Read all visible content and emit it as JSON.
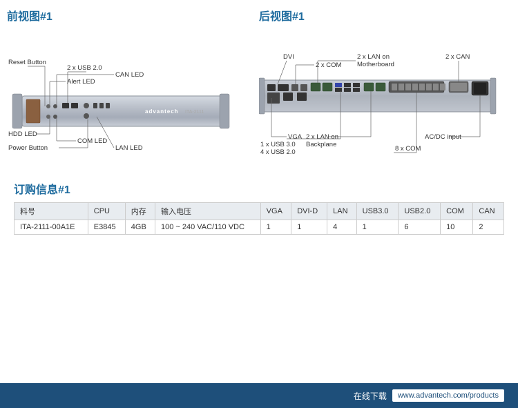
{
  "front_view": {
    "title": "前视图#1",
    "labels": {
      "alert_led": "Alert LED",
      "can_led": "CAN LED",
      "reset_button": "Reset Button",
      "usb": "2 x USB 2.0",
      "hdd_led": "HDD LED",
      "com_led": "COM LED",
      "power_button": "Power Button",
      "lan_led": "LAN LED"
    },
    "chassis_logo": "advantech",
    "chassis_model": "ITA-2111"
  },
  "rear_view": {
    "title": "后视图#1",
    "labels": {
      "dvi": "DVI",
      "two_can": "2 x CAN",
      "two_com": "2 x COM",
      "lan_motherboard": "2 x LAN on\nMotherboard",
      "vga": "VGA",
      "lan_backplane": "2 x LAN on\nBackplane",
      "ac_dc": "AC/DC input",
      "usb_30": "1 x USB 3.0",
      "usb_20": "4 x USB 2.0",
      "eight_com": "8 x COM"
    }
  },
  "ordering": {
    "title": "订购信息#1",
    "headers": [
      "料号",
      "CPU",
      "内存",
      "输入电压",
      "VGA",
      "DVI-D",
      "LAN",
      "USB3.0",
      "USB2.0",
      "COM",
      "CAN"
    ],
    "rows": [
      {
        "part_number": "ITA-2111-00A1E",
        "cpu": "E3845",
        "memory": "4GB",
        "voltage": "100 ~ 240 VAC/110 VDC",
        "vga": "1",
        "dvi_d": "1",
        "lan": "4",
        "usb30": "1",
        "usb20": "6",
        "com": "10",
        "can": "2"
      }
    ]
  },
  "footer": {
    "label": "在线下载",
    "url": "www.advantech.com/products"
  }
}
